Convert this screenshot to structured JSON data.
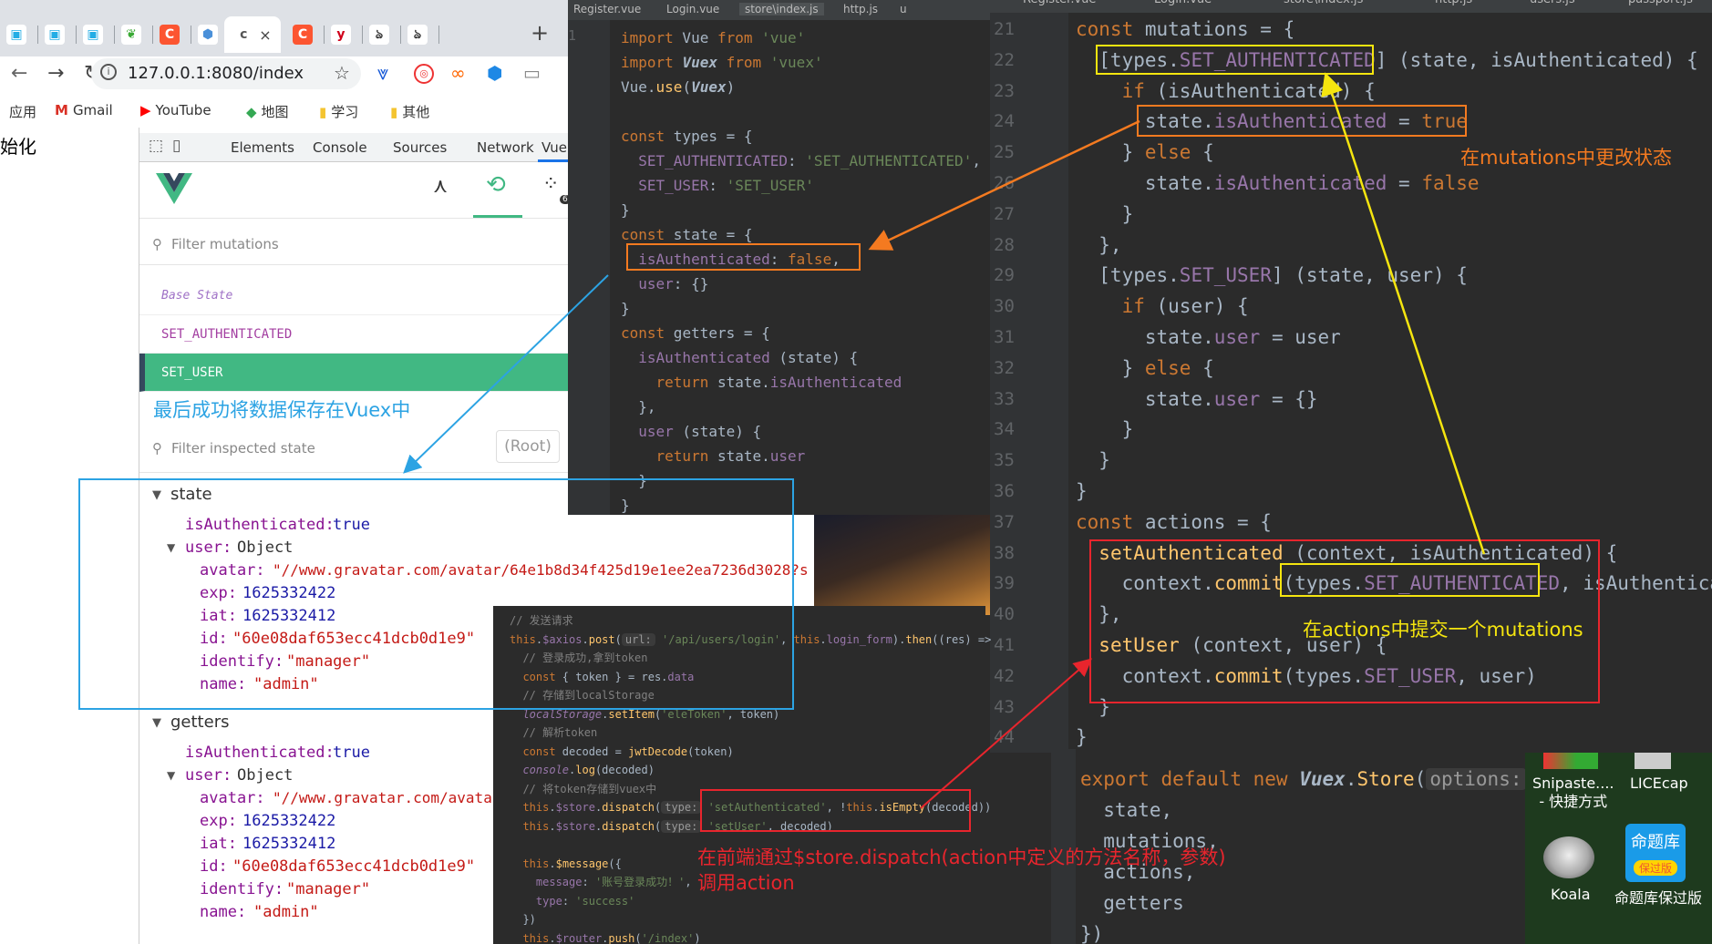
{
  "browser": {
    "address": "127.0.0.1:8080/index",
    "page_left_text": "始化",
    "tabs": [
      {
        "icon": "bilibili-icon",
        "glyph": "▣",
        "bg": "#fff",
        "color": "#23ade5"
      },
      {
        "icon": "bilibili-icon",
        "glyph": "▣",
        "bg": "#fff",
        "color": "#23ade5"
      },
      {
        "icon": "bilibili-icon",
        "glyph": "▣",
        "bg": "#fff",
        "color": "#23ade5"
      },
      {
        "icon": "leaf-icon",
        "glyph": "❦",
        "bg": "#fff",
        "color": "#3aaa35"
      },
      {
        "icon": "csdn-icon",
        "glyph": "C",
        "bg": "#fc5531",
        "color": "#fff"
      },
      {
        "icon": "hexagon-icon",
        "glyph": "⬢",
        "bg": "#fff",
        "color": "#4a90d9"
      }
    ],
    "active_tab_glyph": "c",
    "close_glyph": "×",
    "tabs_after": [
      {
        "icon": "csdn-icon",
        "glyph": "C",
        "bg": "#fc5531",
        "color": "#fff"
      },
      {
        "icon": "yinxiang-icon",
        "glyph": "y",
        "bg": "#fff",
        "color": "#d0021b"
      },
      {
        "icon": "script-icon",
        "glyph": "ঌ",
        "bg": "#fff",
        "color": "#333"
      },
      {
        "icon": "script-icon",
        "glyph": "ঌ",
        "bg": "#fff",
        "color": "#333"
      }
    ],
    "new_tab_glyph": "+",
    "bookmarks": [
      {
        "label": "应用",
        "icon": "apps-icon"
      },
      {
        "label": "Gmail",
        "icon": "gmail-icon"
      },
      {
        "label": "YouTube",
        "icon": "youtube-icon"
      },
      {
        "label": "地图",
        "icon": "maps-icon"
      },
      {
        "label": "学习",
        "icon": "folder-icon"
      },
      {
        "label": "其他",
        "icon": "folder-icon"
      }
    ]
  },
  "devtools": {
    "tabs": [
      "Elements",
      "Console",
      "Sources",
      "Network",
      "Vue"
    ],
    "filter_mutations_placeholder": "Filter mutations",
    "base_state": "Base State",
    "mutations": [
      "SET_AUTHENTICATED",
      "SET_USER"
    ],
    "filter_state_placeholder": "Filter inspected state",
    "root_label": "(Root)",
    "badge": "6",
    "state_section": "state",
    "getters_section": "getters",
    "state": {
      "isAuthenticated_key": "isAuthenticated:",
      "isAuthenticated_val": "true",
      "user_key": "user:",
      "user_type": "Object",
      "avatar_key": "avatar:",
      "avatar_val": "\"//www.gravatar.com/avatar/64e1b8d34f425d19e1ee2ea7236d3028?s",
      "exp_key": "exp:",
      "exp_val": "1625332422",
      "iat_key": "iat:",
      "iat_val": "1625332412",
      "id_key": "id:",
      "id_val": "\"60e08daf653ecc41dcb0d1e9\"",
      "identify_key": "identify:",
      "identify_val": "\"manager\"",
      "name_key": "name:",
      "name_val": "\"admin\""
    },
    "getters": {
      "avatar_val": "\"//www.gravatar.com/avatar"
    }
  },
  "ide1": {
    "tabs": [
      "Register.vue",
      "Login.vue",
      "store\\index.js",
      "http.js",
      "u"
    ],
    "line_numbers": [
      "1",
      "",
      "",
      "",
      "",
      "",
      "",
      "",
      "",
      "",
      "",
      "",
      "",
      "",
      "",
      "",
      "",
      "",
      "",
      ""
    ]
  },
  "ide2": {
    "tabs": [
      "Register.vue",
      "Login.vue",
      "store\\index.js",
      "http.js",
      "users.js",
      "passport.js"
    ],
    "line_numbers": [
      "21",
      "22",
      "23",
      "24",
      "25",
      "26",
      "27",
      "28",
      "29",
      "30",
      "31",
      "32",
      "33",
      "34",
      "35",
      "36",
      "37",
      "38",
      "39",
      "40",
      "41",
      "42",
      "43",
      "44"
    ]
  },
  "ide3": {
    "hint_url": "url:",
    "hint_type": "type:"
  },
  "ide4": {
    "hint_options": "options:"
  },
  "desktop": {
    "icons": [
      {
        "label": "Snipaste....\n- 快捷方式",
        "icon": "snipaste-icon"
      },
      {
        "label": "LICEcap",
        "icon": "licecap-icon"
      },
      {
        "label": "Koala",
        "icon": "koala-icon"
      },
      {
        "label": "命题库保过版",
        "icon": "question-bank-icon"
      }
    ],
    "question_bank_tile": "命题库",
    "question_bank_sub": "保过版"
  },
  "annotations": {
    "mutations_change_state": "在mutations中更改状态",
    "actions_commit": "在actions中提交一个mutations",
    "save_to_vuex": "最后成功将数据保存在Vuex中",
    "dispatch_note_1": "在前端通过$store.dispatch(action中定义的方法名称，参数)",
    "dispatch_note_2": "调用action"
  },
  "colors": {
    "orange": "#f47a20",
    "yellow": "#f5e50f",
    "red": "#e8252d",
    "blue": "#2ca3e3",
    "vue_green": "#41b883"
  }
}
